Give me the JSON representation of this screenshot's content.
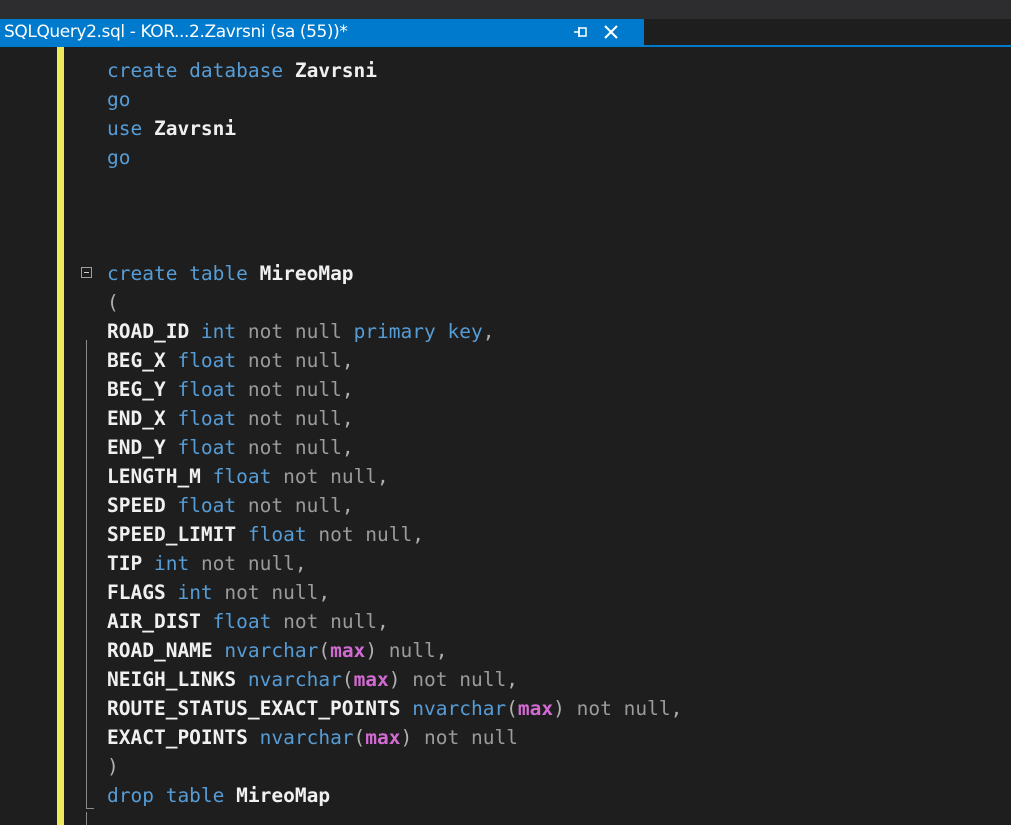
{
  "tab": {
    "title": "SQLQuery2.sql - KOR...2.Zavrsni (sa (55))*",
    "pin_icon": "pin-icon",
    "close_icon": "close-icon"
  },
  "colors": {
    "accent": "#007acc",
    "background": "#1e1e1e",
    "keyword": "#569cd6",
    "null_keyword": "#9b9b9b",
    "function": "#d16ad1",
    "change_bar": "#eeea5a"
  },
  "code": {
    "l1": {
      "k1": "create database ",
      "id": "Zavrsni"
    },
    "l2": {
      "k1": "go"
    },
    "l3": {
      "k1": "use ",
      "id": "Zavrsni"
    },
    "l4": {
      "k1": "go"
    },
    "l8": {
      "k1": "create table ",
      "id": "MireoMap"
    },
    "l9": {
      "p": "("
    },
    "l10": {
      "id": "ROAD_ID ",
      "t": "int ",
      "n": "not null ",
      "k2": "primary key",
      "c": ","
    },
    "l11": {
      "id": "BEG_X ",
      "t": "float ",
      "n": "not null",
      "c": ","
    },
    "l12": {
      "id": "BEG_Y ",
      "t": "float ",
      "n": "not null",
      "c": ","
    },
    "l13": {
      "id": "END_X ",
      "t": "float ",
      "n": "not null",
      "c": ","
    },
    "l14": {
      "id": "END_Y ",
      "t": "float ",
      "n": "not null",
      "c": ","
    },
    "l15": {
      "id": "LENGTH_M ",
      "t": "float ",
      "n": "not null",
      "c": ","
    },
    "l16": {
      "id": "SPEED ",
      "t": "float ",
      "n": "not null",
      "c": ","
    },
    "l17": {
      "id": "SPEED_LIMIT ",
      "t": "float ",
      "n": "not null",
      "c": ","
    },
    "l18": {
      "id": "TIP ",
      "t": "int ",
      "n": "not null",
      "c": ","
    },
    "l19": {
      "id": "FLAGS ",
      "t": "int ",
      "n": "not null",
      "c": ","
    },
    "l20": {
      "id": "AIR_DIST ",
      "t": "float ",
      "n": "not null",
      "c": ","
    },
    "l21": {
      "id": "ROAD_NAME ",
      "t": "nvarchar",
      "p1": "(",
      "m": "max",
      "p2": ") ",
      "n": "null",
      "c": ","
    },
    "l22": {
      "id": "NEIGH_LINKS ",
      "t": "nvarchar",
      "p1": "(",
      "m": "max",
      "p2": ") ",
      "n": "not null",
      "c": ","
    },
    "l23": {
      "id": "ROUTE_STATUS_EXACT_POINTS ",
      "t": "nvarchar",
      "p1": "(",
      "m": "max",
      "p2": ") ",
      "n": "not null",
      "c": ","
    },
    "l24": {
      "id": "EXACT_POINTS ",
      "t": "nvarchar",
      "p1": "(",
      "m": "max",
      "p2": ") ",
      "n": "not null"
    },
    "l25": {
      "p": ")"
    },
    "l26": {
      "k1": "drop table ",
      "id": "MireoMap"
    }
  }
}
